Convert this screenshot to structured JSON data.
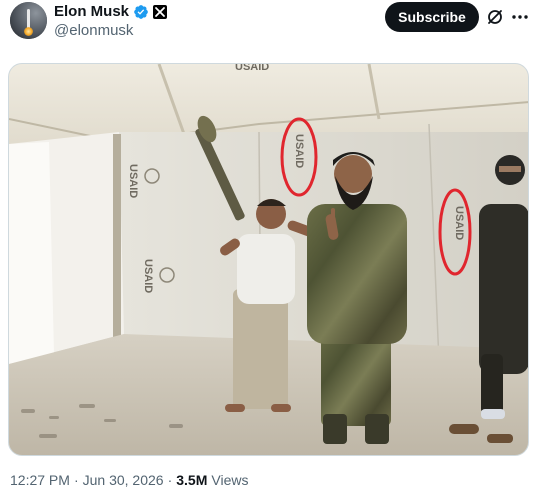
{
  "author": {
    "display_name": "Elon Musk",
    "handle": "@elonmusk"
  },
  "actions": {
    "subscribe_label": "Subscribe"
  },
  "photo": {
    "tent_print_text": "USAID",
    "circle_color": "#e0262e"
  },
  "meta": {
    "time": "12:27 PM",
    "separator": "·",
    "date": "Jun 30, 2026",
    "views_count": "3.5M",
    "views_label": "Views"
  },
  "colors": {
    "verified_blue": "#1d9bf0",
    "subscribe_bg": "#0f1419",
    "secondary_text": "#536471"
  },
  "icons": [
    "verified-badge-icon",
    "x-logo-icon",
    "grok-icon",
    "more-icon"
  ]
}
